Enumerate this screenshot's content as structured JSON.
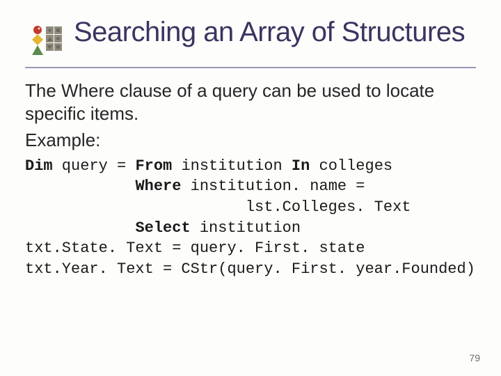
{
  "title": "Searching an Array of Structures",
  "body": {
    "line1": "The Where clause of a query can be used to locate specific items.",
    "line2": "Example:"
  },
  "code": {
    "l1a": "Dim",
    "l1b": " query = ",
    "l1c": "From",
    "l1d": " institution ",
    "l1e": "In",
    "l1f": " colleges",
    "l2a": "            ",
    "l2b": "Where",
    "l2c": " institution. name =",
    "l3": "                        lst.Colleges. Text",
    "l4a": "            ",
    "l4b": "Select",
    "l4c": " institution",
    "l5": "txt.State. Text = query. First. state",
    "l6": "txt.Year. Text = CStr(query. First. year.Founded)"
  },
  "page": "79"
}
